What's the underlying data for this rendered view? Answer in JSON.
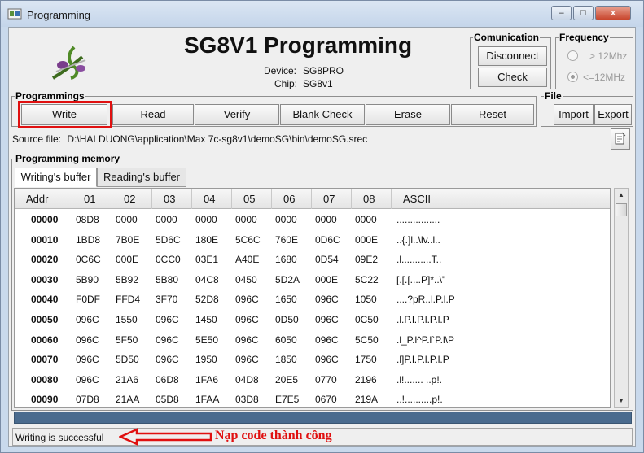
{
  "window": {
    "title": "Programming",
    "minimize": "–",
    "maximize": "□",
    "close": "x"
  },
  "header": {
    "title": "SG8V1 Programming",
    "device_label": "Device:",
    "device_value": "SG8PRO",
    "chip_label": "Chip:",
    "chip_value": "SG8v1"
  },
  "communication": {
    "label": "Comunication",
    "disconnect": "Disconnect",
    "check": "Check"
  },
  "frequency": {
    "label": "Frequency",
    "opt_high": "> 12Mhz",
    "opt_low": "<=12MHz",
    "selected": "<=12MHz"
  },
  "programmings": {
    "label": "Programmings",
    "write": "Write",
    "read": "Read",
    "verify": "Verify",
    "blank_check": "Blank Check",
    "erase": "Erase",
    "reset": "Reset"
  },
  "file": {
    "label": "File",
    "import": "Import",
    "export": "Export"
  },
  "source": {
    "label": "Source file:",
    "path": "D:\\HAI DUONG\\application\\Max 7c-sg8v1\\demoSG\\bin\\demoSG.srec"
  },
  "memory": {
    "label": "Programming memory",
    "tabs": [
      "Writing's buffer",
      "Reading's buffer"
    ],
    "active_tab": "Writing's buffer",
    "columns": [
      "Addr",
      "01",
      "02",
      "03",
      "04",
      "05",
      "06",
      "07",
      "08",
      "ASCII"
    ],
    "rows": [
      [
        "00000",
        "08D8",
        "0000",
        "0000",
        "0000",
        "0000",
        "0000",
        "0000",
        "0000",
        "................"
      ],
      [
        "00010",
        "1BD8",
        "7B0E",
        "5D6C",
        "180E",
        "5C6C",
        "760E",
        "0D6C",
        "000E",
        "..{.]l..\\lv..l.."
      ],
      [
        "00020",
        "0C6C",
        "000E",
        "0CC0",
        "03E1",
        "A40E",
        "1680",
        "0D54",
        "09E2",
        ".l...........T.."
      ],
      [
        "00030",
        "5B90",
        "5B92",
        "5B80",
        "04C8",
        "0450",
        "5D2A",
        "000E",
        "5C22",
        "[.[.[....P]*..\\\""
      ],
      [
        "00040",
        "F0DF",
        "FFD4",
        "3F70",
        "52D8",
        "096C",
        "1650",
        "096C",
        "1050",
        "....?pR..l.P.l.P"
      ],
      [
        "00050",
        "096C",
        "1550",
        "096C",
        "1450",
        "096C",
        "0D50",
        "096C",
        "0C50",
        ".l.P.l.P.l.P.l.P"
      ],
      [
        "00060",
        "096C",
        "5F50",
        "096C",
        "5E50",
        "096C",
        "6050",
        "096C",
        "5C50",
        ".l_P.l^P.l`P.l\\P"
      ],
      [
        "00070",
        "096C",
        "5D50",
        "096C",
        "1950",
        "096C",
        "1850",
        "096C",
        "1750",
        ".l]P.l.P.l.P.l.P"
      ],
      [
        "00080",
        "096C",
        "21A6",
        "06D8",
        "1FA6",
        "04D8",
        "20E5",
        "0770",
        "2196",
        ".l!....... ..p!."
      ],
      [
        "00090",
        "07D8",
        "21AA",
        "05D8",
        "1FAA",
        "03D8",
        "E7E5",
        "0670",
        "219A",
        "..!..........p!."
      ]
    ]
  },
  "status": {
    "text": "Writing is successful"
  },
  "annotation": {
    "text": "Nạp code thành công"
  },
  "colors": {
    "highlight": "#e01010",
    "progress": "#4a6b8e"
  },
  "icons": [
    "app-icon",
    "logo-icon",
    "open-file-icon",
    "arrow-left-icon",
    "scroll-up-icon",
    "scroll-down-icon"
  ]
}
